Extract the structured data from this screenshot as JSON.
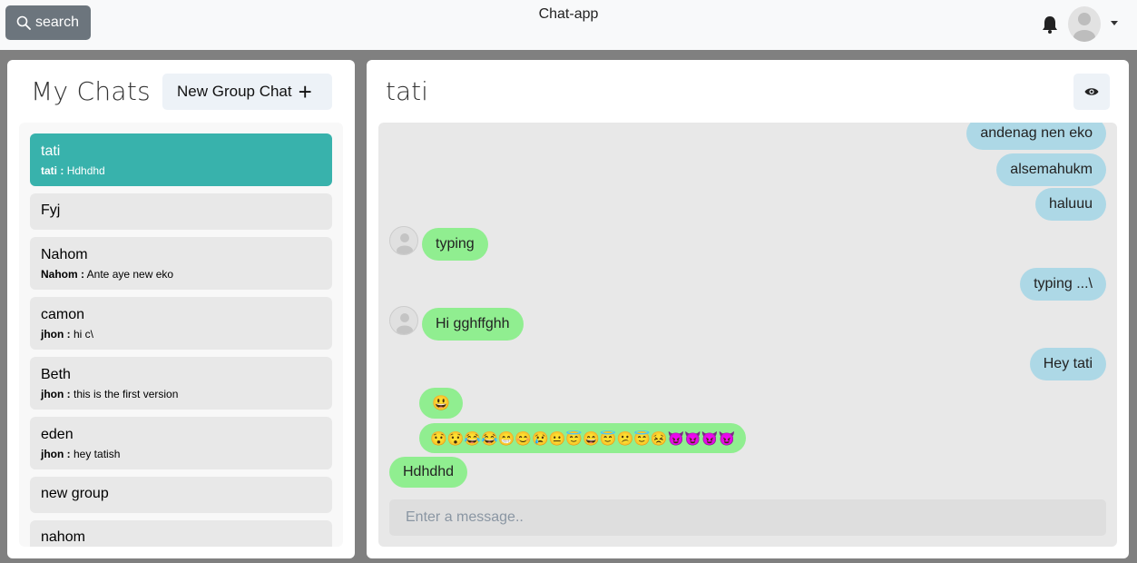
{
  "header": {
    "search_label": "search",
    "app_title": "Chat-app"
  },
  "sidebar": {
    "title": "My Chats",
    "new_group_label": "New Group Chat",
    "chats": [
      {
        "name": "tati",
        "sender": "tati :",
        "message": "Hdhdhd"
      },
      {
        "name": "Fyj"
      },
      {
        "name": "Nahom",
        "sender": "Nahom :",
        "message": "Ante aye new eko"
      },
      {
        "name": "camon",
        "sender": "jhon :",
        "message": "hi c\\"
      },
      {
        "name": "Beth",
        "sender": "jhon :",
        "message": "this is the first version"
      },
      {
        "name": "eden",
        "sender": "jhon :",
        "message": "hey tatish"
      },
      {
        "name": "new group"
      },
      {
        "name": "nahom"
      }
    ]
  },
  "chat": {
    "title": "tati",
    "input_placeholder": "Enter a message..",
    "messages": [
      {
        "text": "andenag nen eko",
        "from": "me"
      },
      {
        "text": "alsemahukm",
        "from": "me"
      },
      {
        "text": "haluuu",
        "from": "me"
      },
      {
        "text": "typing",
        "from": "them"
      },
      {
        "text": "typing ...\\",
        "from": "me"
      },
      {
        "text": "Hi gghffghh",
        "from": "them"
      },
      {
        "text": "Hey tati",
        "from": "me"
      },
      {
        "text": "😃",
        "from": "them"
      },
      {
        "text": "😯😯😂😂😁😊😢😐😇😄😇😕😇😣😈😈😈😈",
        "from": "them"
      },
      {
        "text": "Hdhdhd",
        "from": "them"
      }
    ]
  },
  "colors": {
    "active_chat": "#38b2ac",
    "my_bubble": "#add8e6",
    "their_bubble": "#90ee90"
  }
}
